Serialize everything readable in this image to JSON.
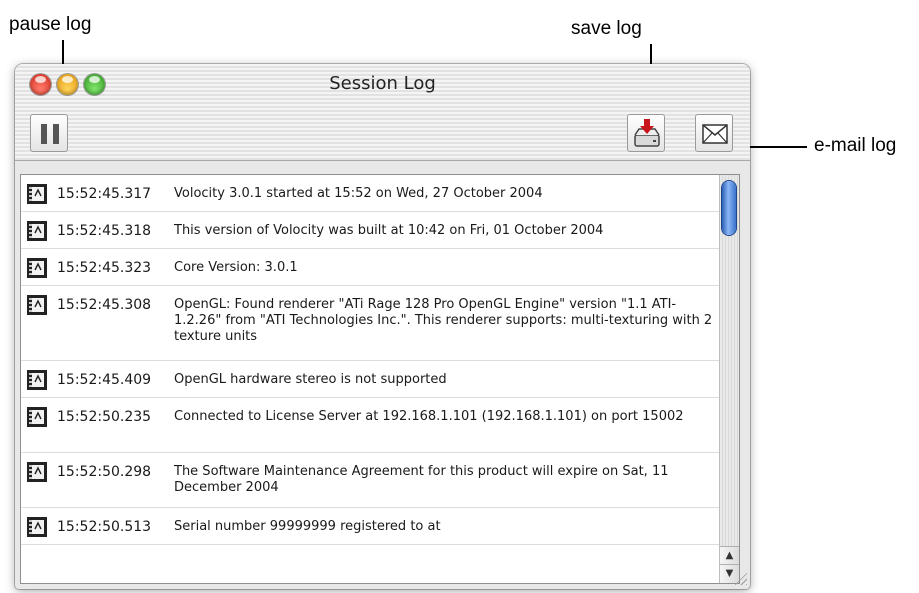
{
  "callouts": {
    "pause": "pause log",
    "save": "save log",
    "email": "e-mail log"
  },
  "window": {
    "title": "Session Log"
  },
  "log": {
    "entries": [
      {
        "time": "15:52:45.317",
        "message": "Volocity 3.0.1 started at 15:52 on Wed, 27 October 2004"
      },
      {
        "time": "15:52:45.318",
        "message": "This version of Volocity was built at 10:42 on Fri, 01 October 2004"
      },
      {
        "time": "15:52:45.323",
        "message": "Core Version: 3.0.1"
      },
      {
        "time": "15:52:45.308",
        "message": "OpenGL: Found renderer \"ATi Rage 128 Pro OpenGL Engine\" version \"1.1 ATI-1.2.26\" from \"ATI Technologies Inc.\".  This renderer supports: multi-texturing with 2 texture units"
      },
      {
        "time": "15:52:45.409",
        "message": "OpenGL hardware stereo is not supported"
      },
      {
        "time": "15:52:50.235",
        "message": "Connected to License Server at 192.168.1.101 (192.168.1.101) on port 15002"
      },
      {
        "time": "15:52:50.298",
        "message": "The Software Maintenance Agreement for this product will expire on Sat, 11 December 2004"
      },
      {
        "time": "15:52:50.513",
        "message": "Serial number 99999999 registered to   at"
      }
    ]
  },
  "scroll": {
    "up_arrow": "▲",
    "down_arrow": "▼"
  },
  "icons": {
    "entry": "log-entry-icon",
    "pause": "pause-icon",
    "save": "save-log-icon",
    "email": "envelope-icon"
  }
}
